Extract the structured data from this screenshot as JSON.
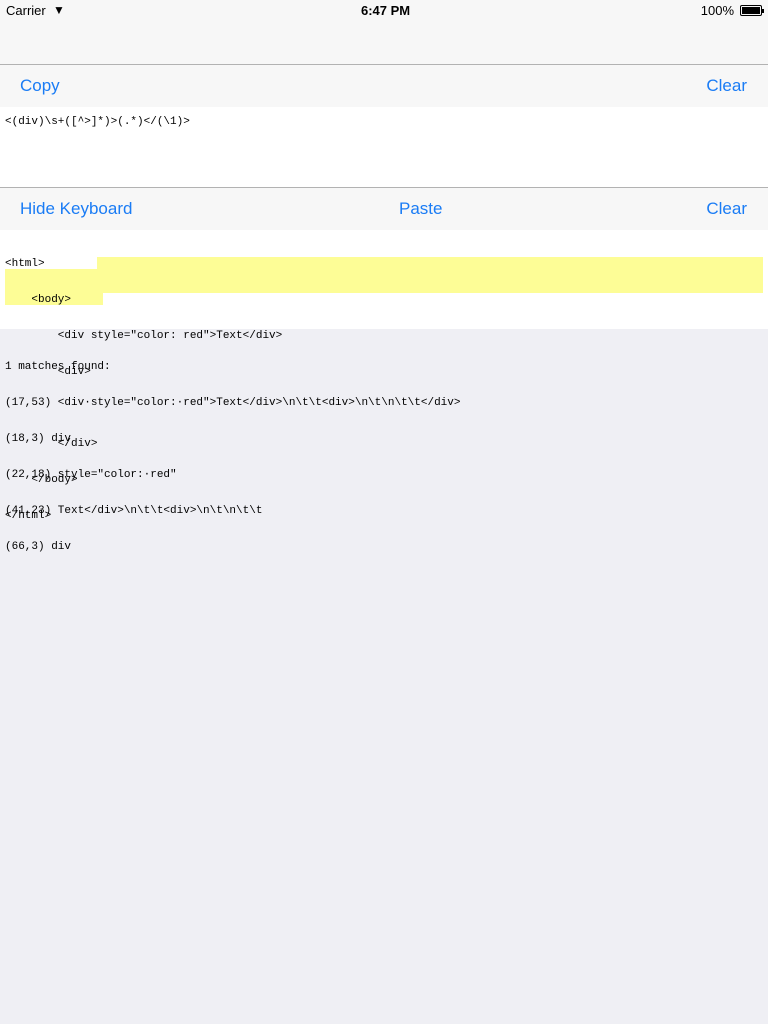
{
  "status": {
    "carrier": "Carrier",
    "time": "6:47 PM",
    "battery": "100%"
  },
  "toolbar1": {
    "copy": "Copy",
    "clear": "Clear"
  },
  "regex": "<(div)\\s+([^>]*)>(.*)</(\\1)>",
  "toolbar2": {
    "hide_keyboard": "Hide Keyboard",
    "paste": "Paste",
    "clear": "Clear"
  },
  "sample_lines": [
    "<html>",
    "    <body>",
    "        <div style=\"color: red\">Text</div>",
    "        <div>",
    "",
    "        </div>",
    "    </body>",
    "</html>"
  ],
  "results": [
    "1 matches found:",
    "(17,53) <div·style=\"color:·red\">Text</div>\\n\\t\\t<div>\\n\\t\\n\\t\\t</div>",
    "(18,3) div",
    "(22,18) style=\"color:·red\"",
    "(41,23) Text</div>\\n\\t\\t<div>\\n\\t\\n\\t\\t",
    "(66,3) div"
  ],
  "colors": {
    "accent": "#1a7cf5",
    "highlight": "#fdfd96"
  }
}
